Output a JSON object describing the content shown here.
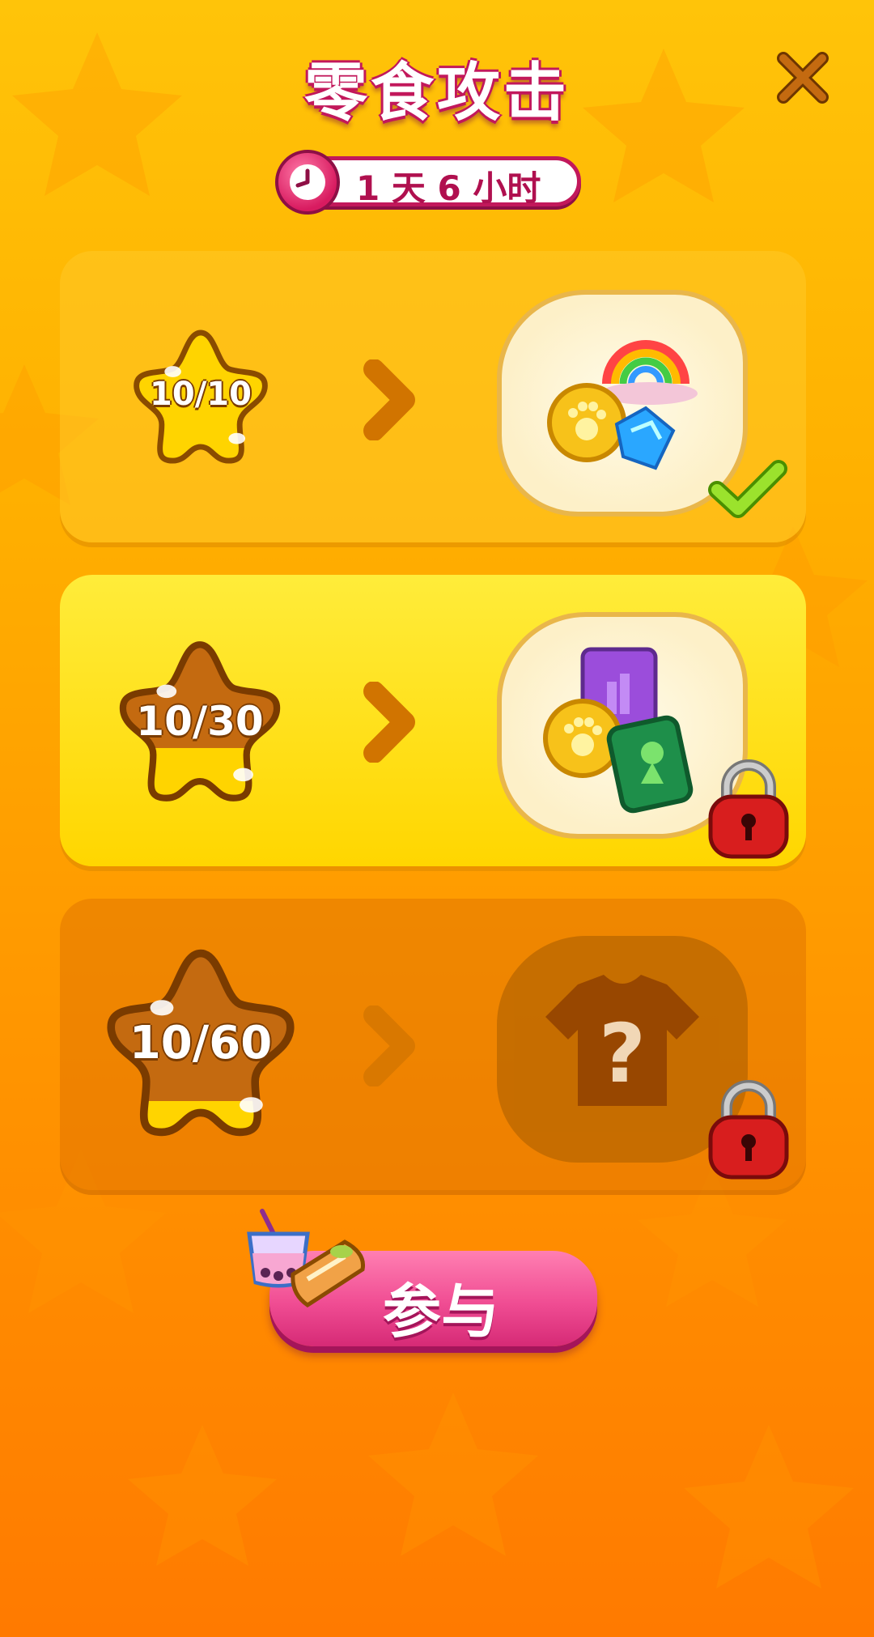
{
  "title": "零食攻击",
  "timer": {
    "text": "1 天 6 小时"
  },
  "tiers": [
    {
      "progress_label": "10/10",
      "progress": 1.0,
      "state": "claimed"
    },
    {
      "progress_label": "10/30",
      "progress": 0.333,
      "state": "locked"
    },
    {
      "progress_label": "10/60",
      "progress": 0.167,
      "state": "locked-hidden"
    }
  ],
  "join_button": {
    "label": "参与"
  },
  "colors": {
    "accent": "#e94b8f",
    "title_outline": "#c2185b",
    "star_gold": "#ffd400",
    "star_brown": "#c46a10"
  },
  "icons": [
    "close-icon",
    "clock-icon",
    "chevron-right-icon",
    "paw-coin-icon",
    "rainbow-icon",
    "gem-icon",
    "ticket-icon",
    "figure-card-icon",
    "shirt-icon",
    "question-icon",
    "check-icon",
    "padlock-icon",
    "drink-icon",
    "pie-icon"
  ]
}
